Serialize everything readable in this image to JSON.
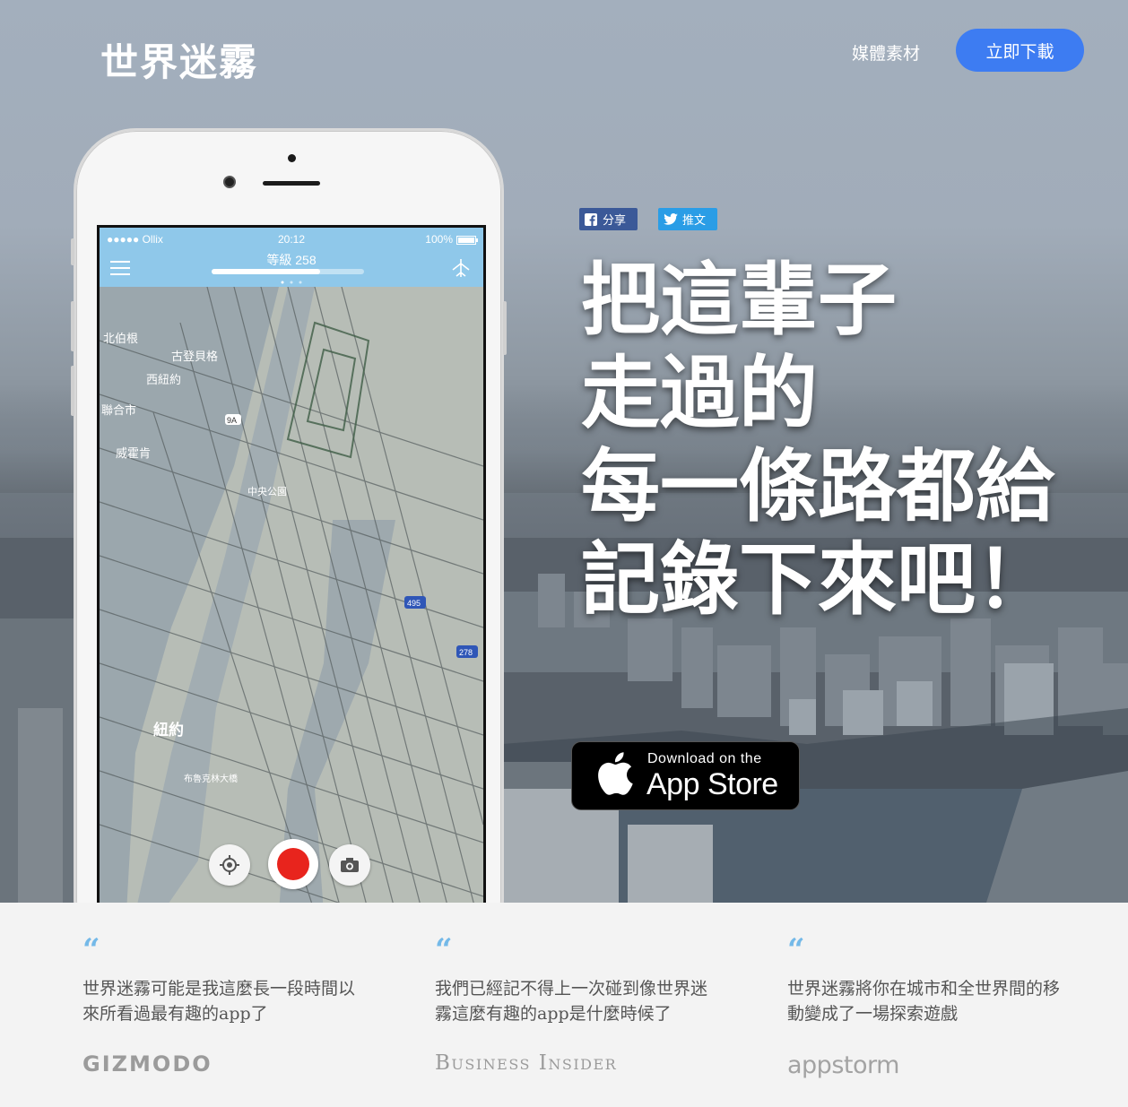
{
  "header": {
    "logo": "世界迷霧",
    "nav_media": "媒體素材",
    "download_label": "立即下載"
  },
  "phone": {
    "carrier": "●●●●● Ollix",
    "time": "20:12",
    "battery": "100%",
    "level_label": "等級 258",
    "level_progress": 0.71,
    "map_labels": [
      "北伯根",
      "古登貝格",
      "西紐約",
      "聯合市",
      "威霍肯",
      "中央公園",
      "紐約",
      "布魯克林大橋",
      "9A",
      "278",
      "495"
    ]
  },
  "share": {
    "facebook_label": "分享",
    "twitter_label": "推文"
  },
  "headline": {
    "lines": [
      "把這輩子",
      "走過的",
      "每一條路都給",
      "記錄下來吧！"
    ]
  },
  "appstore": {
    "small_text": "Download on the",
    "big_text": "App Store"
  },
  "quotes": [
    {
      "text": "世界迷霧可能是我這麼長一段時間以來所看過最有趣的app了",
      "brand": "GIZMODO"
    },
    {
      "text": "我們已經記不得上一次碰到像世界迷霧這麼有趣的app是什麼時候了",
      "brand": "Business Insider"
    },
    {
      "text": "世界迷霧將你在城市和全世界間的移動變成了一場探索遊戲",
      "brand": "appstorm"
    }
  ],
  "colors": {
    "accent_button": "#3d7cf2",
    "facebook": "#3b5998",
    "twitter": "#2a9de6",
    "quote_mark": "#74b9e8",
    "record": "#e8241d"
  },
  "icons": [
    "menu-icon",
    "paper-plane-icon",
    "location-icon",
    "record-icon",
    "camera-icon",
    "facebook-icon",
    "twitter-icon",
    "apple-icon"
  ]
}
